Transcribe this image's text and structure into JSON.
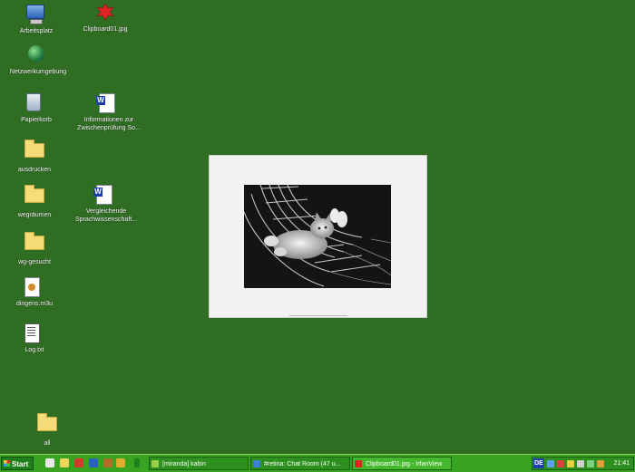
{
  "desktop": {
    "background": "#2f6e22",
    "icons": [
      {
        "id": "arbeitsplatz",
        "label": "Arbeitsplatz",
        "icon": "computer-icon"
      },
      {
        "id": "clipboard",
        "label": "Clipboard01.jpg",
        "icon": "jpg-file-icon"
      },
      {
        "id": "netzwerk",
        "label": "Netzwerkumgebung",
        "icon": "network-icon"
      },
      {
        "id": "papierkorb",
        "label": "Papierkorb",
        "icon": "recycle-bin-icon"
      },
      {
        "id": "informationen",
        "label_line1": "Informationen zur",
        "label_line2": "Zwischenprüfung So...",
        "icon": "word-document-icon"
      },
      {
        "id": "ausdrucken",
        "label": "ausdrucken",
        "icon": "folder-icon"
      },
      {
        "id": "wegraeumen",
        "label": "wegräumen",
        "icon": "folder-icon"
      },
      {
        "id": "vergleichende",
        "label_line1": "Vergleichende",
        "label_line2": "Sprachwissenschaft...",
        "icon": "word-document-icon"
      },
      {
        "id": "wg",
        "label": "wg-gesucht",
        "icon": "folder-icon"
      },
      {
        "id": "dingens",
        "label": "dingens.m3u",
        "icon": "playlist-file-icon"
      },
      {
        "id": "log",
        "label": "Log.txt",
        "icon": "text-file-icon"
      },
      {
        "id": "all",
        "label": "all",
        "icon": "folder-icon"
      }
    ]
  },
  "viewer": {
    "image": "cat-in-hammock-photo"
  },
  "taskbar": {
    "start_label": "Start",
    "tasks": [
      {
        "label": "[miranda] kabin",
        "icon": "miranda-icon"
      },
      {
        "label": "#retina: Chat Room (47 u...",
        "icon": "chat-icon"
      },
      {
        "label": "Clipboard01.jpg - IrfanView",
        "icon": "irfanview-icon",
        "active": true
      }
    ],
    "tray": {
      "language": "DE",
      "clock": "21:41"
    }
  },
  "colors": {
    "taskbar": "#37a321",
    "accent": "#2d8f1d"
  }
}
